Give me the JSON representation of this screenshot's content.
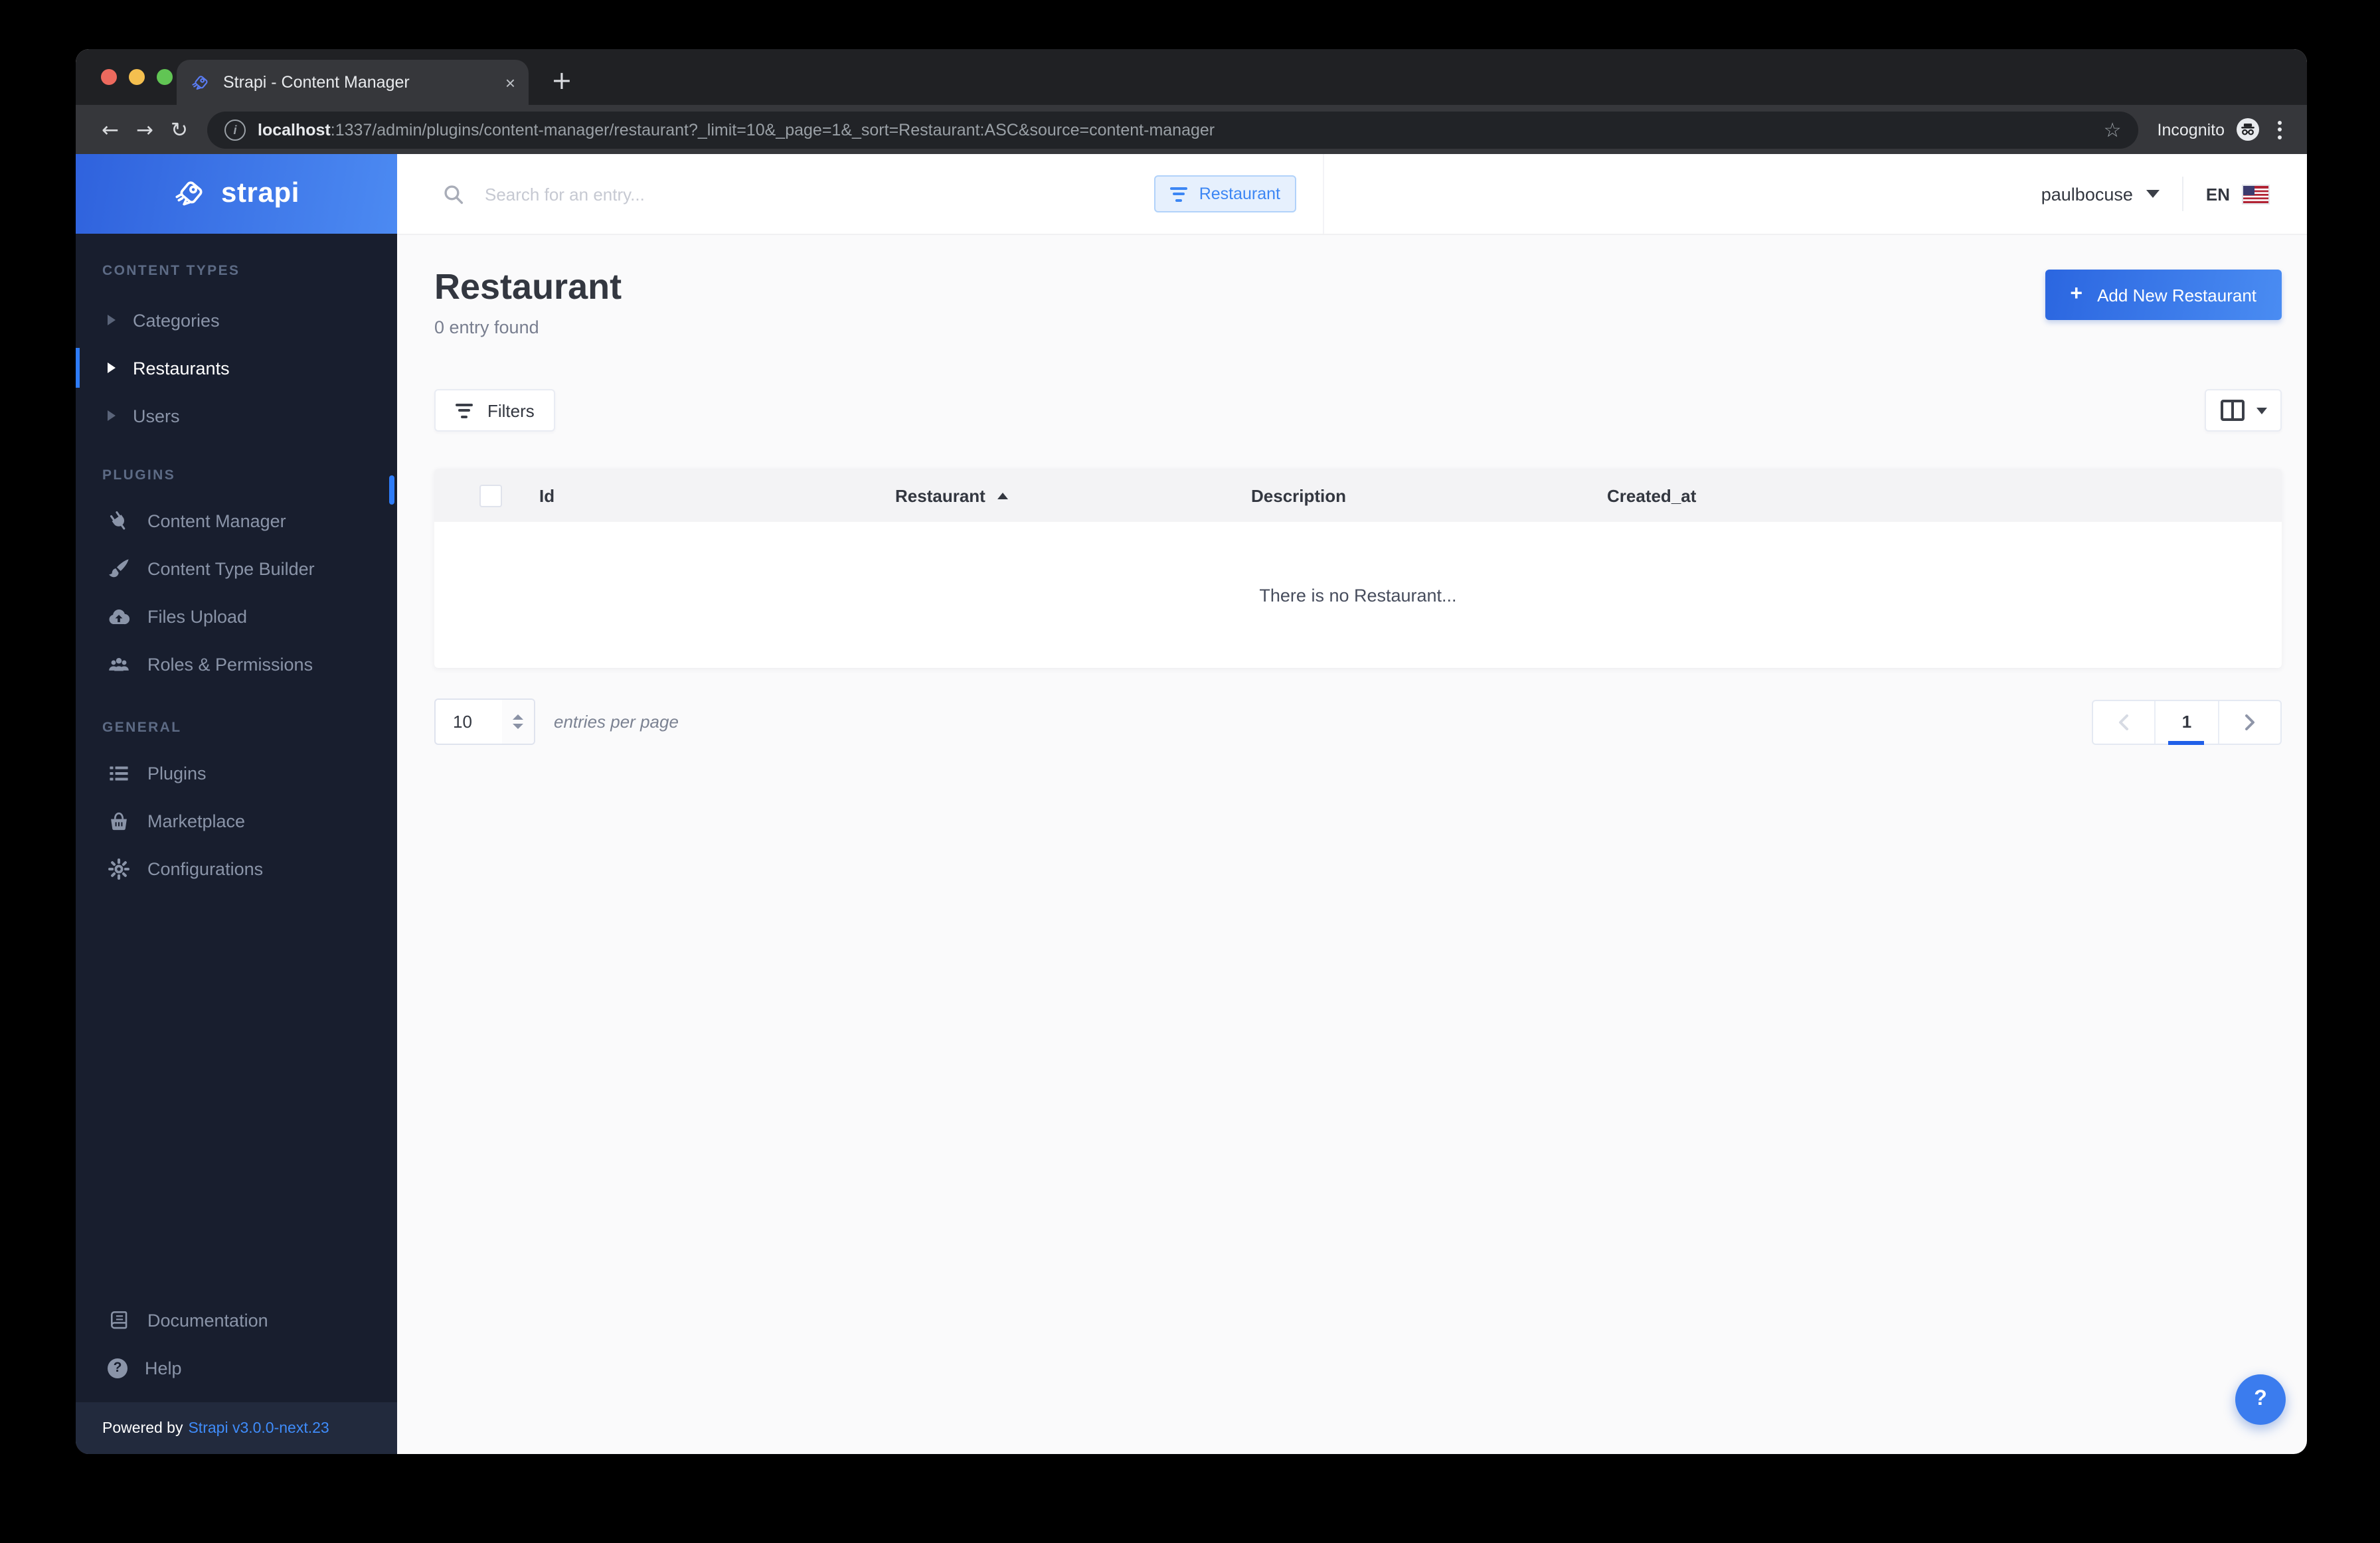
{
  "browser": {
    "tab_title": "Strapi - Content Manager",
    "url_host": "localhost",
    "url_rest": ":1337/admin/plugins/content-manager/restaurant?_limit=10&_page=1&_sort=Restaurant:ASC&source=content-manager",
    "incognito_label": "Incognito"
  },
  "icons": {
    "back": "←",
    "forward": "→",
    "reload": "↻",
    "star": "☆",
    "tab_close": "×",
    "info": "i",
    "plus": "+",
    "question": "?"
  },
  "sidebar": {
    "logo_text": "strapi",
    "content_types": {
      "label": "CONTENT TYPES",
      "items": [
        {
          "label": "Categories",
          "icon": "caret-right-icon"
        },
        {
          "label": "Restaurants",
          "icon": "caret-right-icon",
          "active": true
        },
        {
          "label": "Users",
          "icon": "caret-right-icon"
        }
      ]
    },
    "plugins_section": {
      "label": "PLUGINS",
      "items": [
        {
          "label": "Content Manager",
          "icon": "plug-icon"
        },
        {
          "label": "Content Type Builder",
          "icon": "paintbrush-icon"
        },
        {
          "label": "Files Upload",
          "icon": "cloud-upload-icon"
        },
        {
          "label": "Roles & Permissions",
          "icon": "users-icon"
        }
      ]
    },
    "general_section": {
      "label": "GENERAL",
      "items": [
        {
          "label": "Plugins",
          "icon": "list-icon"
        },
        {
          "label": "Marketplace",
          "icon": "basket-icon"
        },
        {
          "label": "Configurations",
          "icon": "gear-icon"
        }
      ]
    },
    "footer_links": [
      {
        "label": "Documentation",
        "icon": "book-icon"
      },
      {
        "label": "Help",
        "icon": "help-icon"
      }
    ],
    "powered_by": "Powered by",
    "version_link": "Strapi v3.0.0-next.23"
  },
  "header": {
    "search_placeholder": "Search for an entry...",
    "filter_chip": "Restaurant",
    "user_name": "paulbocuse",
    "language": "EN"
  },
  "page": {
    "title": "Restaurant",
    "subtitle": "0 entry found",
    "add_button_label": "Add New Restaurant",
    "filters_label": "Filters",
    "table": {
      "columns": [
        "Id",
        "Restaurant",
        "Description",
        "Created_at"
      ],
      "sorted_column": "Restaurant",
      "sort_direction": "asc",
      "empty_message": "There is no Restaurant..."
    },
    "pagination": {
      "entries_per_page": "10",
      "entries_label": "entries per page",
      "current_page": "1"
    }
  },
  "colors": {
    "accent_blue": "#3b82f6",
    "sidebar_bg": "#181e2e",
    "button_gradient_start": "#2b66e0",
    "button_gradient_end": "#4a8cf2",
    "chip_bg": "#e6f0fd"
  }
}
